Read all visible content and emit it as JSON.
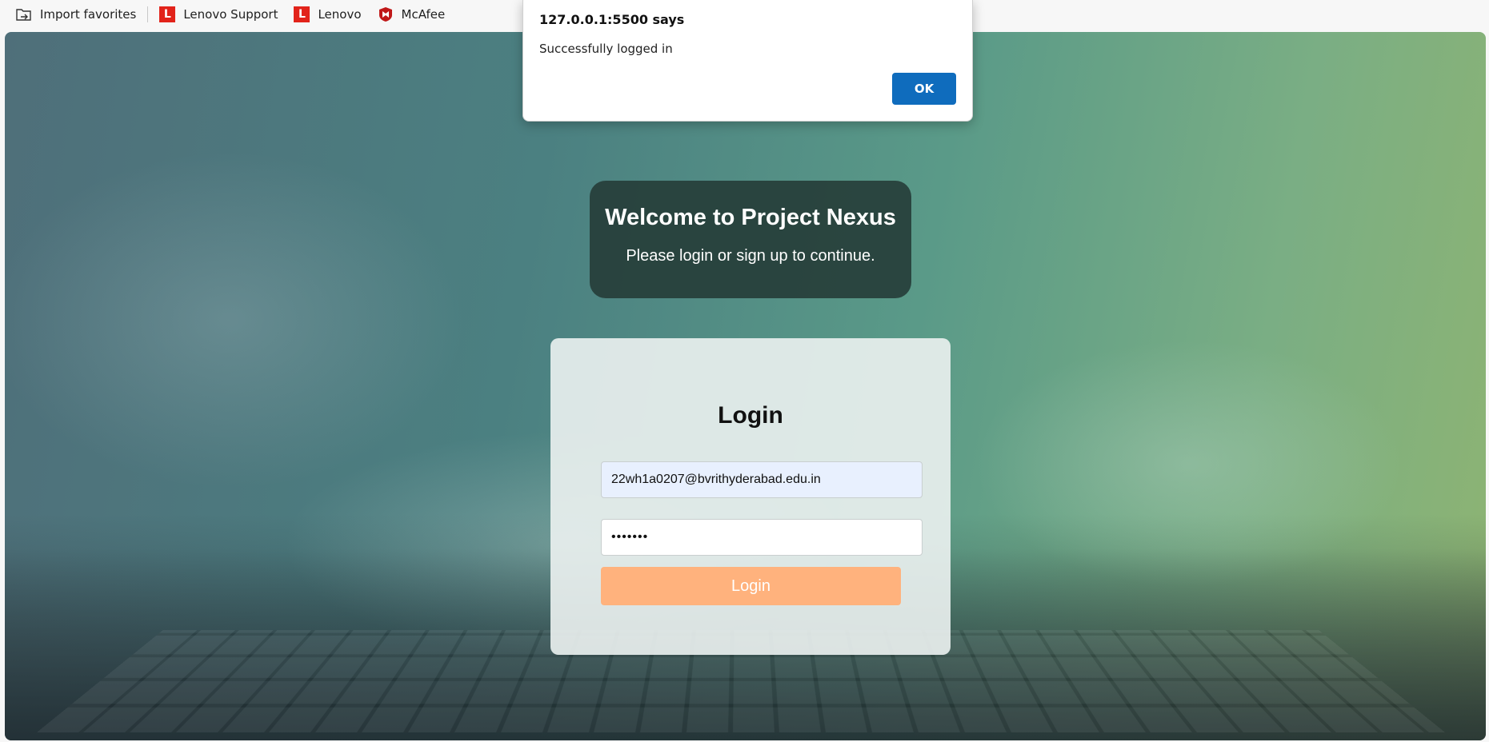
{
  "favorites_bar": {
    "items": [
      {
        "label": "Import favorites",
        "icon": "import-favorites-icon"
      },
      {
        "label": "Lenovo Support",
        "icon": "lenovo-icon"
      },
      {
        "label": "Lenovo",
        "icon": "lenovo-icon"
      },
      {
        "label": "McAfee",
        "icon": "mcafee-icon"
      }
    ],
    "lenovo_icon_letter": "L"
  },
  "alert": {
    "title": "127.0.0.1:5500 says",
    "message": "Successfully logged in",
    "ok_label": "OK"
  },
  "welcome": {
    "title": "Welcome to Project Nexus",
    "subtitle": "Please login or sign up to continue."
  },
  "login": {
    "heading": "Login",
    "email_value": "22wh1a0207@bvrithyderabad.edu.in",
    "password_value": "•••••••",
    "button_label": "Login"
  },
  "colors": {
    "login_button": "#ffb27d",
    "welcome_box": "#263e3a",
    "alert_ok": "#0f6cbd",
    "email_autofill_bg": "#e8f0fe",
    "lenovo_red": "#e2231a"
  }
}
